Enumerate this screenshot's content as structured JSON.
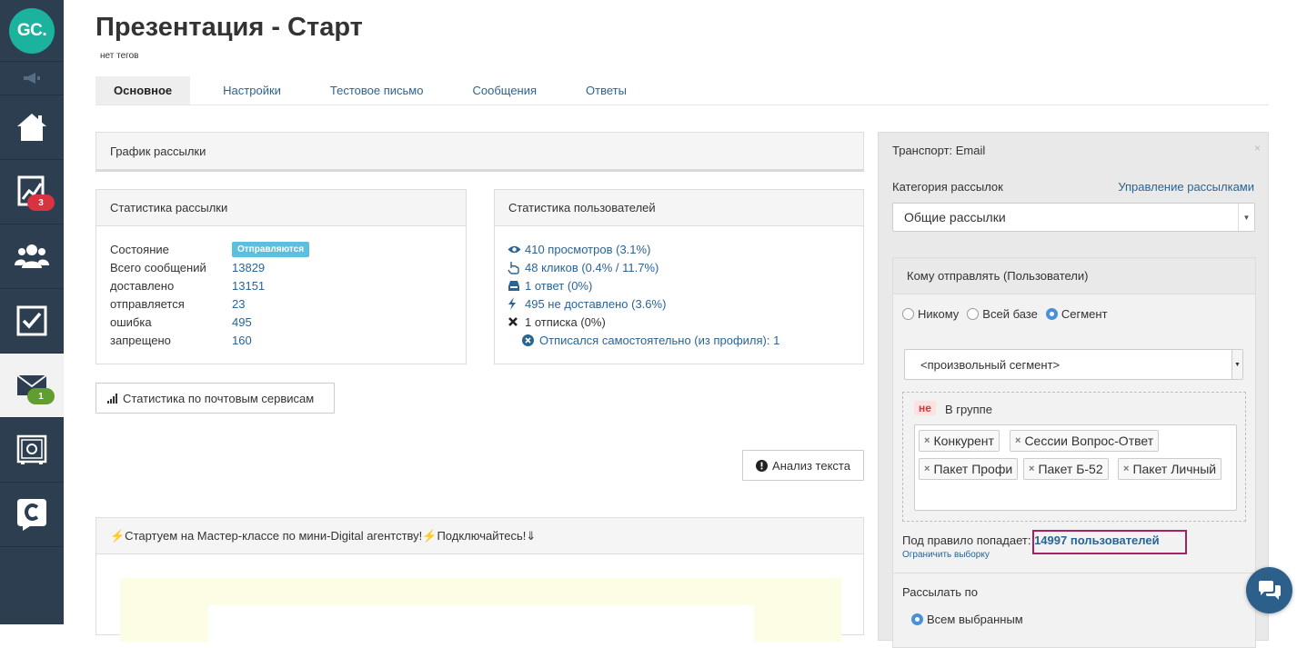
{
  "sidebar": {
    "logo_text": "GC.",
    "items": [
      {
        "icon": "home-icon"
      },
      {
        "icon": "chart-icon",
        "badge": "3"
      },
      {
        "icon": "users-icon"
      },
      {
        "icon": "tasks-icon"
      },
      {
        "icon": "mail-icon",
        "badge": "1",
        "active": true
      },
      {
        "icon": "safe-icon"
      },
      {
        "icon": "c-logo-icon"
      }
    ]
  },
  "header": {
    "title": "Презентация - Старт",
    "tags": "нет тегов"
  },
  "tabs": [
    "Основное",
    "Настройки",
    "Тестовое письмо",
    "Сообщения",
    "Ответы"
  ],
  "schedule": {
    "title": "График рассылки"
  },
  "stats": {
    "title": "Статистика рассылки",
    "rows": [
      {
        "key": "Состояние",
        "value": "Отправляются"
      },
      {
        "key": "Всего сообщений",
        "value": "13829"
      },
      {
        "key": "доставлено",
        "value": "13151"
      },
      {
        "key": "отправляется",
        "value": "23"
      },
      {
        "key": "ошибка",
        "value": "495"
      },
      {
        "key": "запрещено",
        "value": "160"
      }
    ]
  },
  "user_stats": {
    "title": "Статистика пользователей",
    "views": "410 просмотров (3.1%)",
    "clicks": "48 кликов (0.4% / 11.7%)",
    "replies": "1 ответ (0%)",
    "not_delivered": "495 не доставлено (3.6%)",
    "unsubscribes": "1 отписка (0%)",
    "self_unsub": "Отписался самостоятельно (из профиля): 1"
  },
  "buttons": {
    "mail_services": "Статистика по почтовым сервисам",
    "text_analysis": "Анализ текста"
  },
  "promo": {
    "title": "⚡️Стартуем на Мастер-классе по мини-Digital агентству!⚡️Подключайтесь!⇓"
  },
  "right": {
    "transport": "Транспорт: Email",
    "close": "×",
    "category_label": "Категория рассылок",
    "category_link": "Управление рассылками",
    "category_value": "Общие рассылки",
    "recipients_title": "Кому отправлять (Пользователи)",
    "radios": [
      {
        "label": "Никому",
        "checked": false
      },
      {
        "label": "Всей базе",
        "checked": false
      },
      {
        "label": "Сегмент",
        "checked": true
      }
    ],
    "segment_value": "<произвольный сегмент>",
    "not_label": "не",
    "in_group": "В группе",
    "groups": [
      "Конкурент",
      "Сессии Вопрос-Ответ",
      "Пакет Профи",
      "Пакет Б-52",
      "Пакет Личный"
    ],
    "rule_prefix": "Под правило попадает:",
    "rule_count": "14997 пользователей",
    "limit_link": "Ограничить выборку",
    "send_by": "Рассылать по",
    "all_selected": "Всем выбранным"
  },
  "colors": {
    "sidebar_bg": "#2c3e50",
    "logo_bg": "#1bb39e",
    "link": "#2a6496",
    "status_badge": "#5bc0de",
    "badge_red": "#d9333f",
    "badge_green": "#5f9e2f",
    "highlight": "#a3225f"
  }
}
